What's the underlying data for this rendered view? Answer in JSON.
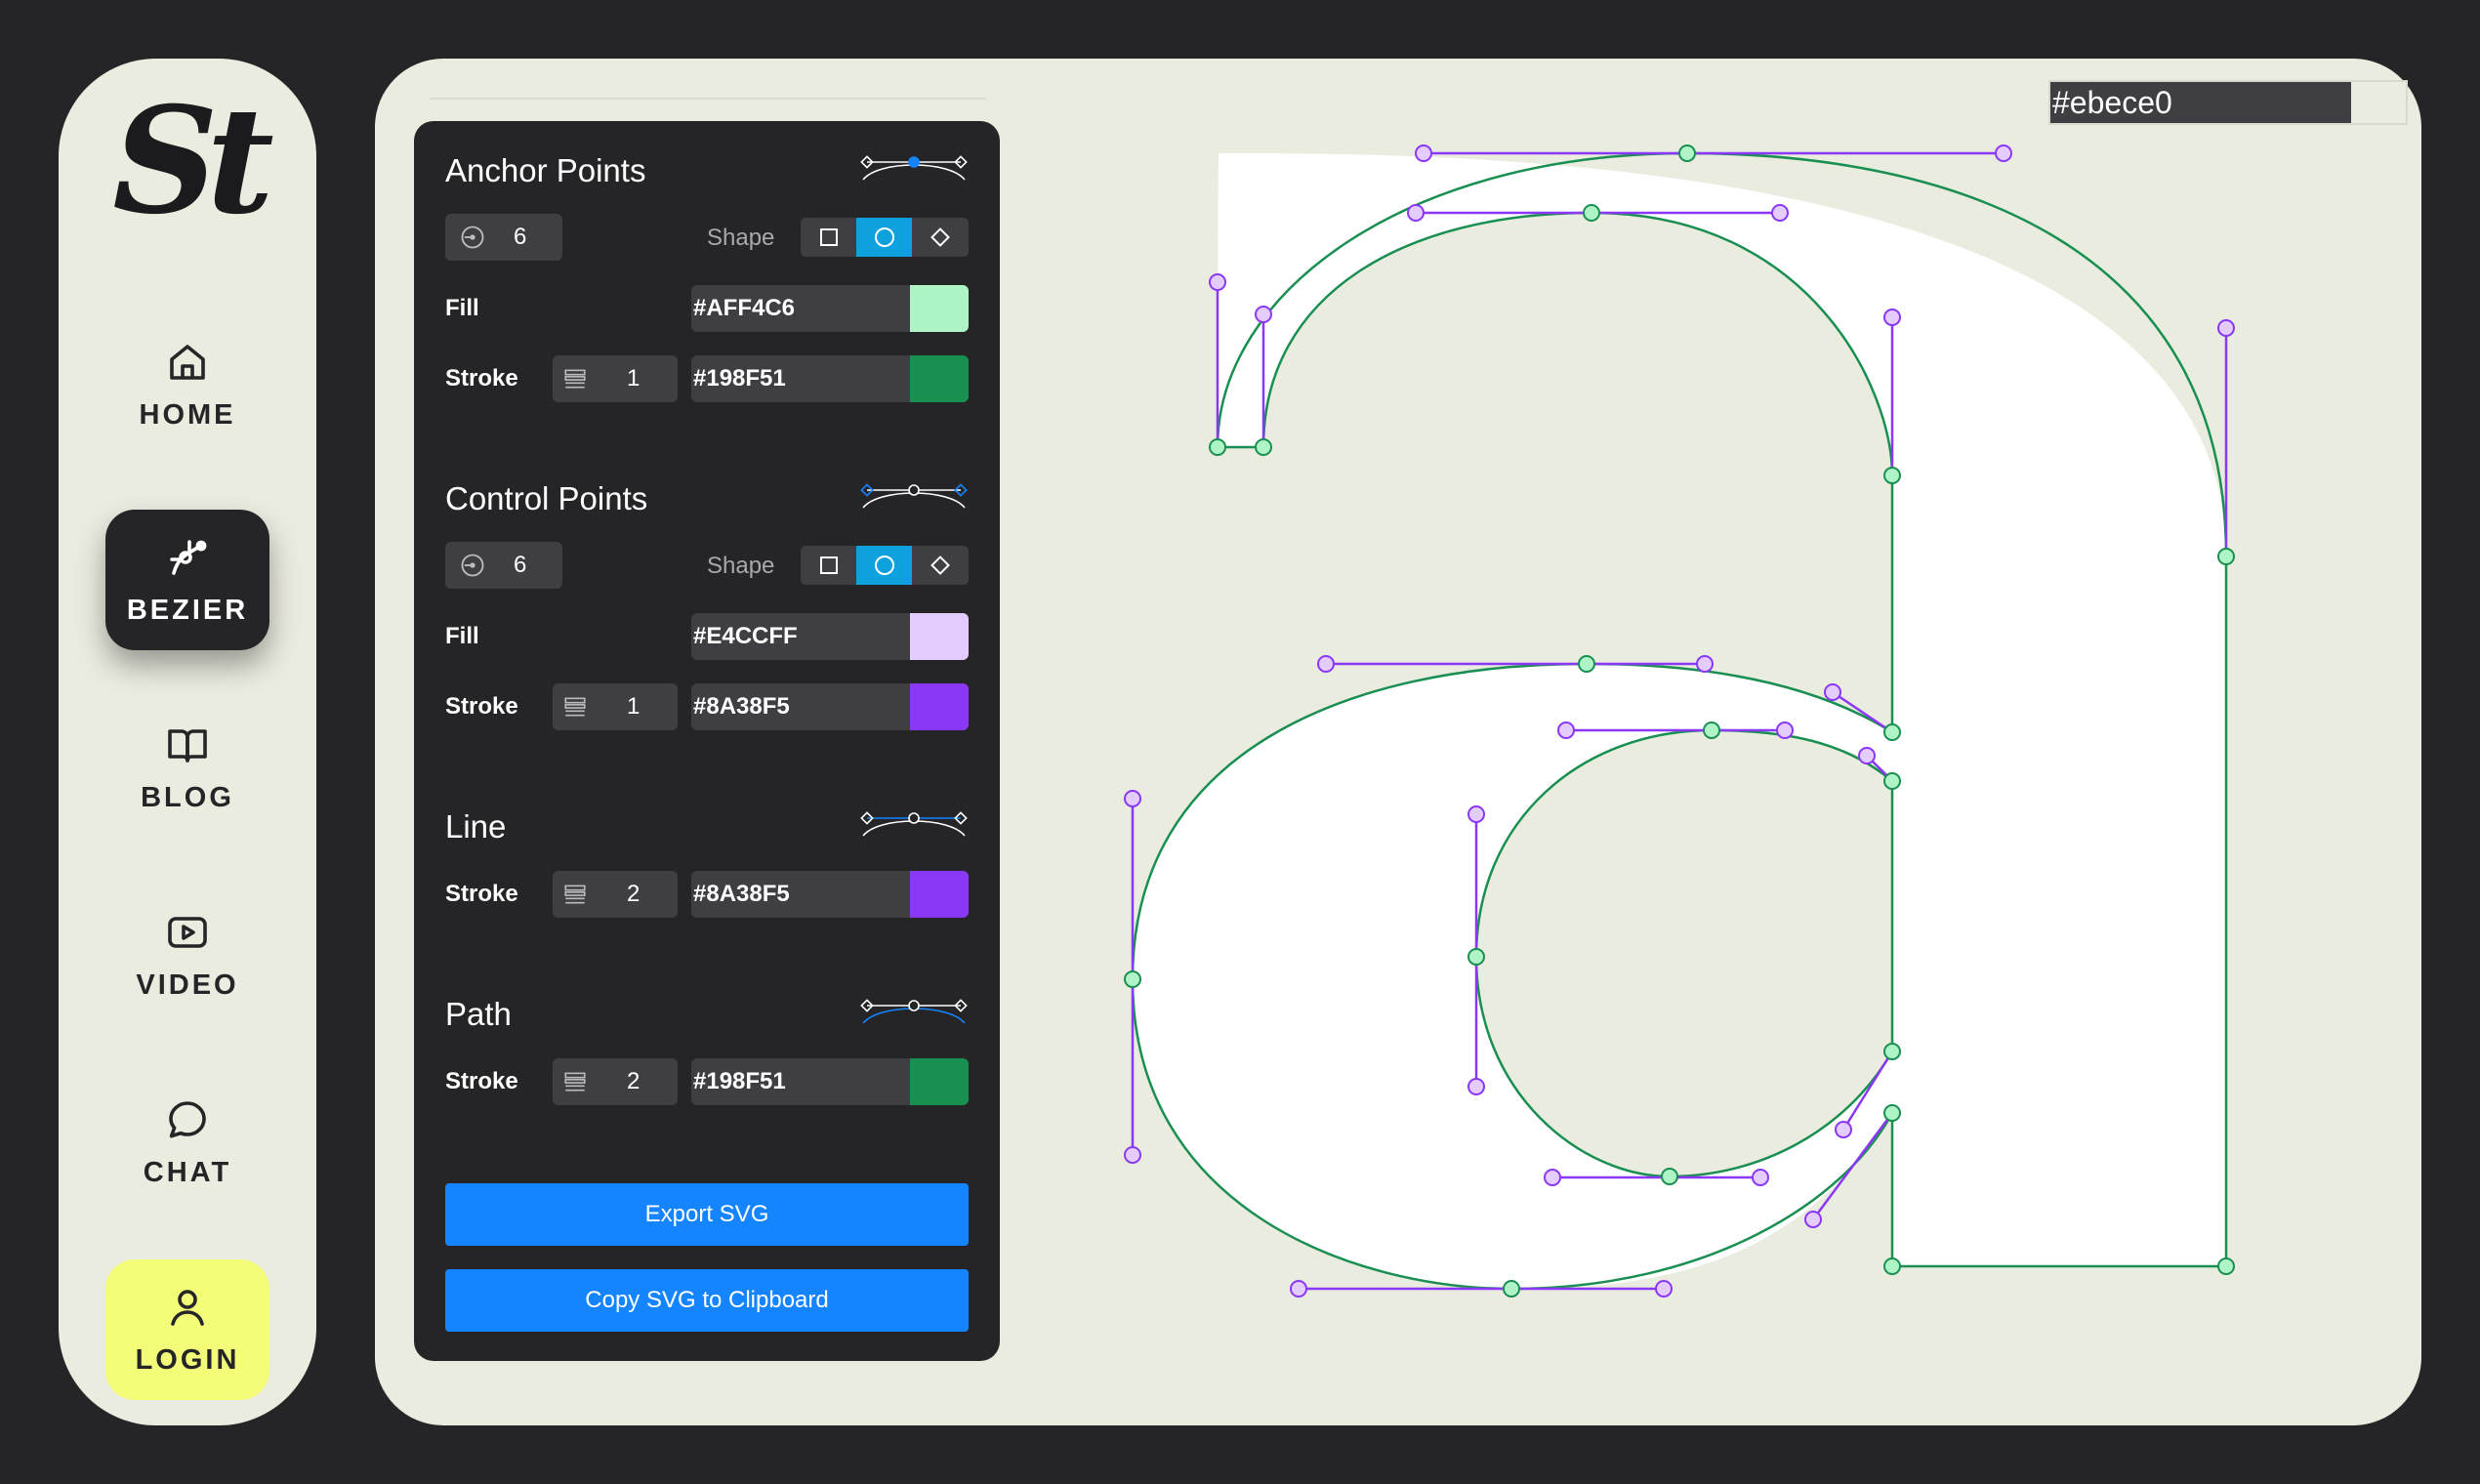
{
  "app": {
    "logo": "St"
  },
  "nav": {
    "home": "HOME",
    "bezier": "BEZIER",
    "blog": "BLOG",
    "video": "VIDEO",
    "chat": "CHAT",
    "login": "LOGIN"
  },
  "canvas": {
    "background_color": "#ebece0"
  },
  "panel": {
    "anchor_points": {
      "title": "Anchor Points",
      "count": "6",
      "shape_label": "Shape",
      "shape_selected": "circle",
      "fill_label": "Fill",
      "fill_hex": "#AFF4C6",
      "stroke_label": "Stroke",
      "stroke_width": "1",
      "stroke_hex": "#198F51"
    },
    "control_points": {
      "title": "Control Points",
      "count": "6",
      "shape_label": "Shape",
      "shape_selected": "circle",
      "fill_label": "Fill",
      "fill_hex": "#E4CCFF",
      "stroke_label": "Stroke",
      "stroke_width": "1",
      "stroke_hex": "#8A38F5"
    },
    "line": {
      "title": "Line",
      "stroke_label": "Stroke",
      "stroke_width": "2",
      "stroke_hex": "#8A38F5"
    },
    "path": {
      "title": "Path",
      "stroke_label": "Stroke",
      "stroke_width": "2",
      "stroke_hex": "#198F51"
    },
    "export_label": "Export SVG",
    "copy_label": "Copy SVG to Clipboard"
  },
  "icons": {
    "home": "home-icon",
    "bezier": "bezier-icon",
    "blog": "book-icon",
    "video": "video-icon",
    "chat": "chat-icon",
    "login": "user-icon",
    "count": "anchor-count-icon",
    "stroke": "stroke-width-icon"
  }
}
